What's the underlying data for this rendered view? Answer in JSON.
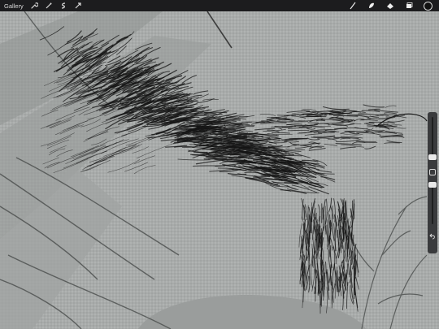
{
  "toolbar": {
    "gallery_label": "Gallery",
    "left_tools": [
      {
        "icon": "wrench-icon"
      },
      {
        "icon": "magic-wand-icon"
      },
      {
        "icon": "selection-icon"
      },
      {
        "icon": "transform-icon"
      }
    ],
    "right_tools": [
      {
        "icon": "brush-icon"
      },
      {
        "icon": "smudge-icon"
      },
      {
        "icon": "eraser-icon"
      },
      {
        "icon": "layers-icon"
      }
    ],
    "current_color": "#111111"
  },
  "sidebar": {
    "brush_size_icon": "brush-size-slider",
    "opacity_icon": "opacity-slider",
    "modify_icon": "modify-square-icon",
    "undo_icon": "undo-icon"
  },
  "colors": {
    "toolbar_bg": "#1c1c1e",
    "canvas_bg": "#a9acab",
    "ink": "#1a1a1a"
  }
}
